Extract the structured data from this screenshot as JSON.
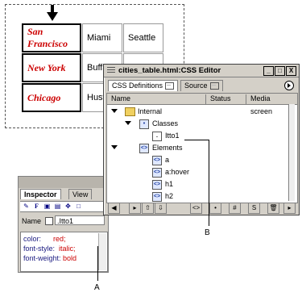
{
  "table": {
    "rows": [
      {
        "city": "San Francisco",
        "col2": "Miami",
        "col3": "Seattle"
      },
      {
        "city": "New York",
        "col2": "Buffa"
      },
      {
        "city": "Chicago",
        "col2": "Hust"
      }
    ]
  },
  "editor": {
    "title": "cities_table.html:CSS Editor",
    "window_buttons": [
      "_",
      "□",
      "X"
    ],
    "tabs": [
      "CSS Definitions",
      "Source"
    ],
    "columns": [
      "Name",
      "Status",
      "Media"
    ],
    "rows": [
      {
        "label": "Internal",
        "status": "",
        "media": "screen"
      },
      {
        "label": "Classes",
        "status": "",
        "media": ""
      },
      {
        "label": "Itto1",
        "status": "",
        "media": ""
      },
      {
        "label": "Elements",
        "status": "",
        "media": ""
      },
      {
        "label": "a",
        "status": "",
        "media": ""
      },
      {
        "label": "a:hover",
        "status": "",
        "media": ""
      },
      {
        "label": "h1",
        "status": "",
        "media": ""
      },
      {
        "label": "h2",
        "status": "",
        "media": ""
      }
    ],
    "toolbar_buttons": [
      "◀",
      "▸",
      "⇧",
      "⇩",
      "<>",
      "•",
      "#",
      "S",
      "🗑",
      "▸"
    ]
  },
  "inspector": {
    "tabs": [
      "Inspector",
      "View"
    ],
    "name_label": "Name",
    "name_value": ".Itto1",
    "code": [
      {
        "prop": "color:",
        "val": "red;"
      },
      {
        "prop": "font-style:",
        "val": "italic;"
      },
      {
        "prop": "font-weight:",
        "val": "bold"
      }
    ]
  },
  "callouts": {
    "a": "A",
    "b": "B"
  },
  "colors": {
    "city_red": "#cc0000",
    "code_blue": "#1a1a80"
  }
}
